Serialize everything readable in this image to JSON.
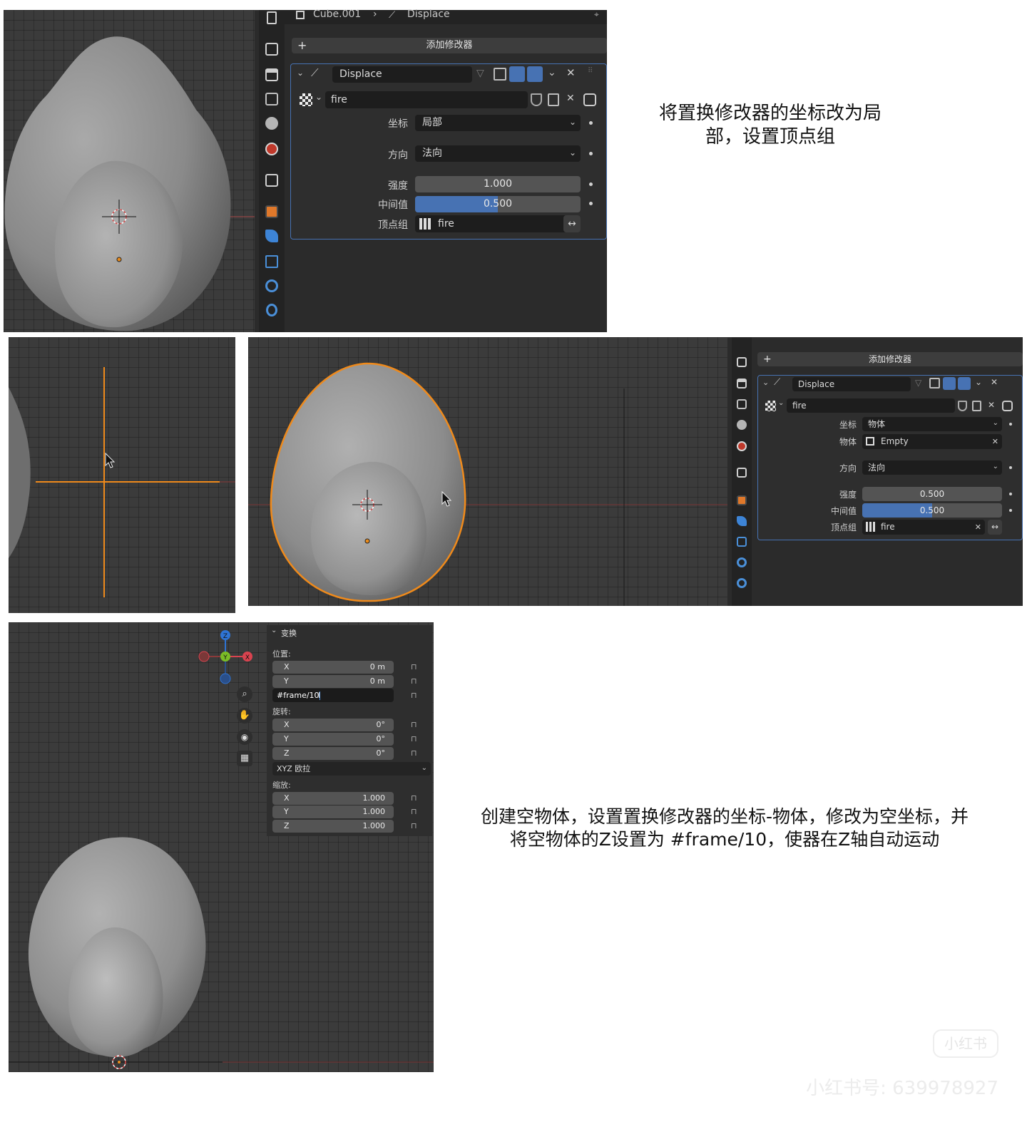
{
  "panel1": {
    "breadcrumb_object": "Cube.001",
    "breadcrumb_separator": "›",
    "breadcrumb_modifier": "Displace",
    "add_modifier": "添加修改器",
    "add_icon": "+",
    "modifier_name": "Displace",
    "texture_name": "fire",
    "coordinates_label": "坐标",
    "coordinates_value": "局部",
    "direction_label": "方向",
    "direction_value": "法向",
    "strength_label": "强度",
    "strength_value": "1.000",
    "midlevel_label": "中间值",
    "midlevel_value": "0.500",
    "midlevel_fraction": 0.5,
    "vertex_group_label": "顶点组",
    "vertex_group_value": "fire"
  },
  "panel2": {
    "add_modifier": "添加修改器",
    "add_icon": "+",
    "modifier_name": "Displace",
    "texture_name": "fire",
    "coordinates_label": "坐标",
    "coordinates_value": "物体",
    "object_label": "物体",
    "object_value": "Empty",
    "direction_label": "方向",
    "direction_value": "法向",
    "strength_label": "强度",
    "strength_value": "0.500",
    "midlevel_label": "中间值",
    "midlevel_value": "0.500",
    "midlevel_fraction": 0.5,
    "vertex_group_label": "顶点组",
    "vertex_group_value": "fire"
  },
  "transform": {
    "header": "变换",
    "location_label": "位置:",
    "loc_x_label": "X",
    "loc_x_value": "0 m",
    "loc_y_label": "Y",
    "loc_y_value": "0 m",
    "loc_z_input": "#frame/10",
    "rotation_label": "旋转:",
    "rot_x_label": "X",
    "rot_x_value": "0°",
    "rot_y_label": "Y",
    "rot_y_value": "0°",
    "rot_z_label": "Z",
    "rot_z_value": "0°",
    "rotation_mode": "XYZ 欧拉",
    "scale_label": "缩放:",
    "scale_x_label": "X",
    "scale_x_value": "1.000",
    "scale_y_label": "Y",
    "scale_y_value": "1.000",
    "scale_z_label": "Z",
    "scale_z_value": "1.000"
  },
  "gizmo": {
    "z": "Z",
    "y": "Y",
    "x": "X"
  },
  "captions": {
    "caption1_line1": "将置换修改器的坐标改为局",
    "caption1_line2": "部，设置顶点组",
    "caption2_line1": "创建空物体，设置置换修改器的坐标-物体，修改为空坐标，并",
    "caption2_line2": "将空物体的Z设置为 #frame/10，使器在Z轴自动运动"
  },
  "watermark": {
    "badge": "小红书",
    "id_text": "小红书号: 639978927"
  },
  "colors": {
    "accent_blue": "#4772b3",
    "selection_orange": "#ef8a1b",
    "axis_red": "#d9434f",
    "axis_green": "#7bbd26",
    "axis_blue": "#2e74d5",
    "viewport_bg": "#3b3b3b"
  },
  "icons": [
    "tool-icon",
    "render-icon",
    "output-icon",
    "view-layer-icon",
    "scene-icon",
    "world-icon",
    "collection-icon",
    "object-icon",
    "modifier-wrench-icon",
    "particles-icon",
    "physics-icon",
    "constraints-icon",
    "pin-icon",
    "displace-icon",
    "texture-checker-icon",
    "vertex-group-icon",
    "filter-icon",
    "edit-mode-icon",
    "realtime-icon",
    "render-camera-icon",
    "close-icon",
    "chevron-down-icon",
    "shield-icon",
    "copy-icon",
    "toggle-icon",
    "swap-icon",
    "zoom-icon",
    "hand-icon",
    "camera-icon",
    "grid-icon",
    "lock-icon",
    "mouse-cursor-icon",
    "text-cursor-icon",
    "empty-object-icon"
  ]
}
